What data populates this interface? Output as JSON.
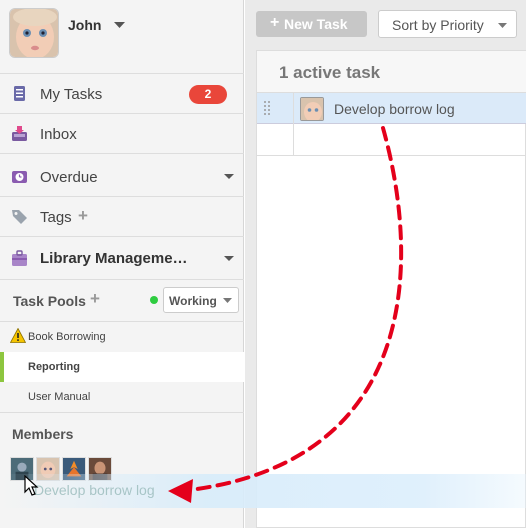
{
  "profile": {
    "name": "John"
  },
  "nav": {
    "my_tasks": {
      "label": "My Tasks",
      "badge": "2"
    },
    "inbox": {
      "label": "Inbox"
    },
    "overdue": {
      "label": "Overdue"
    },
    "tags": {
      "label": "Tags"
    },
    "project": {
      "label": "Library Manageme…"
    }
  },
  "pools": {
    "title": "Task Pools",
    "status": "Working",
    "items": [
      {
        "label": "Book Borrowing"
      },
      {
        "label": "Reporting"
      },
      {
        "label": "User Manual"
      }
    ]
  },
  "members": {
    "title": "Members"
  },
  "toolbar": {
    "new_task": "New Task",
    "sort": "Sort by Priority"
  },
  "tasks": {
    "header": "1 active task",
    "items": [
      {
        "title": "Develop borrow log"
      }
    ]
  },
  "drag": {
    "ghost_text": "Develop borrow log"
  },
  "colors": {
    "badge": "#e9463a",
    "active_pool": "#8dc63f",
    "status_dot": "#2ecc40",
    "drag_arrow": "#e4001b",
    "selected_row": "#dbeaf9"
  }
}
